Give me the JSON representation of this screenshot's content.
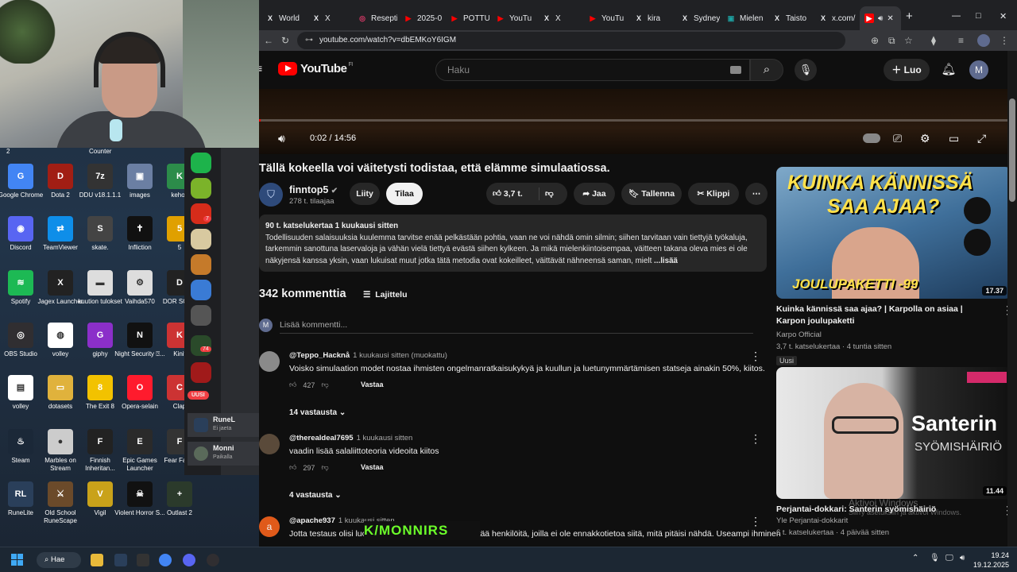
{
  "desktop": {
    "icons": [
      {
        "label": "Google Chrome",
        "color": "#4285f4",
        "glyph": "G"
      },
      {
        "label": "Dota 2",
        "color": "#a11e14",
        "glyph": "D"
      },
      {
        "label": "DDU v18.1.1.1",
        "color": "#333",
        "glyph": "7z"
      },
      {
        "label": "images",
        "color": "#6b7fa3",
        "glyph": "▣"
      },
      {
        "label": "kehok",
        "color": "#2c8c4a",
        "glyph": "K"
      },
      {
        "label": "Discord",
        "color": "#5865f2",
        "glyph": "◉"
      },
      {
        "label": "TeamViewer",
        "color": "#0e8ee9",
        "glyph": "⇄"
      },
      {
        "label": "skate.",
        "color": "#444",
        "glyph": "S"
      },
      {
        "label": "Infliction",
        "color": "#111",
        "glyph": "✝"
      },
      {
        "label": "5",
        "color": "#e0a000",
        "glyph": "5"
      },
      {
        "label": "Spotify",
        "color": "#1db954",
        "glyph": "≋"
      },
      {
        "label": "Jagex Launcher",
        "color": "#222",
        "glyph": "X"
      },
      {
        "label": "kuution tulokset",
        "color": "#ddd",
        "glyph": "▬"
      },
      {
        "label": "Vaihda570",
        "color": "#ddd",
        "glyph": "⚙"
      },
      {
        "label": "DOR SCRE",
        "color": "#222",
        "glyph": "D"
      },
      {
        "label": "OBS Studio",
        "color": "#302e31",
        "glyph": "◎"
      },
      {
        "label": "volley",
        "color": "#fff",
        "glyph": "◍"
      },
      {
        "label": "giphy",
        "color": "#8b2fc9",
        "glyph": "G"
      },
      {
        "label": "Night Security ⍰...",
        "color": "#111",
        "glyph": "N"
      },
      {
        "label": "Kinit",
        "color": "#c33",
        "glyph": "K"
      },
      {
        "label": "volley",
        "color": "#fff",
        "glyph": "▤"
      },
      {
        "label": "dotasets",
        "color": "#e0b23c",
        "glyph": "▭"
      },
      {
        "label": "The Exit 8",
        "color": "#f2c200",
        "glyph": "8"
      },
      {
        "label": "Opera-selain",
        "color": "#ff1b2d",
        "glyph": "O"
      },
      {
        "label": "Clap",
        "color": "#c33",
        "glyph": "C"
      },
      {
        "label": "Steam",
        "color": "#1b2838",
        "glyph": "♨"
      },
      {
        "label": "Marbles on Stream",
        "color": "#ccc",
        "glyph": "●"
      },
      {
        "label": "Finnish Inheritan...",
        "color": "#222",
        "glyph": "F"
      },
      {
        "label": "Epic Games Launcher",
        "color": "#2a2a2a",
        "glyph": "E"
      },
      {
        "label": "Fear Fathe",
        "color": "#333",
        "glyph": "F"
      },
      {
        "label": "RuneLite",
        "color": "#2a3f5a",
        "glyph": "RL"
      },
      {
        "label": "Old School RuneScape",
        "color": "#6b4a2a",
        "glyph": "⚔"
      },
      {
        "label": "Vigil",
        "color": "#c9a21a",
        "glyph": "V"
      },
      {
        "label": "Violent Horror S...",
        "color": "#111",
        "glyph": "☠"
      },
      {
        "label": "Outlast 2",
        "color": "#2b3a2b",
        "glyph": "+"
      }
    ],
    "above_icons_labels": [
      "2",
      "Counter"
    ]
  },
  "discord": {
    "badges": [
      "7",
      "74"
    ],
    "new_label": "UUSI",
    "items": [
      {
        "name": "RuneL",
        "status": "Ei jaeta"
      },
      {
        "name": "Monni",
        "status": "Paikalla"
      }
    ]
  },
  "browser": {
    "tabs": [
      {
        "label": "World",
        "fav": "#e8eaed",
        "glyph": "X"
      },
      {
        "label": "X",
        "fav": "#e8eaed",
        "glyph": "X"
      },
      {
        "label": "Resepti",
        "fav": "#e03a6a",
        "glyph": "◎"
      },
      {
        "label": "2025-0",
        "fav": "#ff0000",
        "glyph": "▶"
      },
      {
        "label": "POTTU",
        "fav": "#ff0000",
        "glyph": "▶"
      },
      {
        "label": "YouTu",
        "fav": "#ff0000",
        "glyph": "▶"
      },
      {
        "label": "X",
        "fav": "#e8eaed",
        "glyph": "X"
      },
      {
        "label": "YouTu",
        "fav": "#ff0000",
        "glyph": "▶"
      },
      {
        "label": "kira",
        "fav": "#e8eaed",
        "glyph": "X"
      },
      {
        "label": "Sydney",
        "fav": "#e8eaed",
        "glyph": "X"
      },
      {
        "label": "Mielen",
        "fav": "#1da1a1",
        "glyph": "▣"
      },
      {
        "label": "Taisto",
        "fav": "#e8eaed",
        "glyph": "X"
      },
      {
        "label": "x.com/",
        "fav": "#e8eaed",
        "glyph": "X"
      }
    ],
    "url": "youtube.com/watch?v=dbEMKoY6IGM",
    "new_tab": "+"
  },
  "youtube": {
    "region": "FI",
    "search_placeholder": "Haku",
    "create_label": "Luo",
    "avatar_letter": "M",
    "progress_fraction": 0.002,
    "time": "0:02 / 14:56",
    "title": "Tällä kokeella voi väitetysti todistaa, että elämme simulaatiossa.",
    "channel": "finntop5",
    "subscribers": "278 t. tilaajaa",
    "join_label": "Liity",
    "subscribe_label": "Tilaa",
    "likes": "3,7 t.",
    "share_label": "Jaa",
    "save_label": "Tallenna",
    "clip_label": "Klippi",
    "desc_meta": "90 t. katselukertaa  1 kuukausi sitten",
    "desc_text": "Todellisuuden salaisuuksia kuulemma tarvitse enää pelkästään pohtia, vaan ne voi nähdä omin silmin; siihen tarvitaan vain tiettyjä työkaluja, tarkemmin sanottuna laservaloja ja vähän vielä tiettyä evästä siihen kylkeen. Ja mikä mielenkiintoisempaa, väitteen takana oleva mies ei ole näkyjensä kanssa yksin, vaan lukuisat muut jotka tätä metodia ovat kokeilleet, väittävät nähneensä saman, mielt",
    "desc_more": "...lisää",
    "comment_count": "342 kommenttia",
    "sort_label": "Lajittelu",
    "add_comment": "Lisää kommentti...",
    "comments": [
      {
        "author": "@Teppo_Hacknå",
        "time": "1 kuukausi sitten (muokattu)",
        "text": "Voisko simulaation modet nostaa ihmisten ongelmanratkaisukykyä ja kuullun ja luetunymmärtämisen statseja ainakin 50%, kiitos.",
        "likes": "427",
        "reply": "Vastaa",
        "replies": "14 vastausta",
        "avatar": "#8a8a8a"
      },
      {
        "author": "@therealdeal7695",
        "time": "1 kuukausi sitten",
        "text": "vaadin lisää salaliittoteoria videoita kiitos",
        "likes": "297",
        "reply": "Vastaa",
        "replies": "4 vastausta",
        "avatar": "#5a4a3a"
      },
      {
        "author": "@apache937",
        "time": "1 kuukausi sitten",
        "text": "Jotta testaus olisi luotettavaa, testaajina pitäisi käyttää henkilöitä, joilla ei ole ennakkotietoa siitä, mitä pitäisi nähdä. Useampi ihminen",
        "likes": "",
        "reply": "",
        "replies": "",
        "avatar": "#e05a1a"
      }
    ],
    "recommendations": [
      {
        "thumb_top": "KUINKA KÄNNISSÄ",
        "thumb_sub": "SAA AJAA?",
        "thumb_bottom": "JOULUPAKETTI -99",
        "duration": "17.37",
        "title": "Kuinka kännissä saa ajaa? | Karpolla on asiaa | Karpon joulupaketti",
        "channel": "Karpo Official",
        "meta": "3,7 t. katselukertaa · 4 tuntia sitten",
        "badge": "Uusi"
      },
      {
        "thumb_top": "Santerin",
        "thumb_sub": "SYÖMISHÄIRIÖ",
        "thumb_bottom": "",
        "duration": "11.44",
        "title": "Perjantai-dokkari: Santerin syömishäiriö",
        "channel": "Yle Perjantai-dokkarit",
        "meta": "6 t. katselukertaa · 4 päivää sitten",
        "badge": ""
      }
    ],
    "watermark_title": "Aktivoi Windows",
    "watermark_sub": "Siirry asetuksiin ja aktivoi Windows.",
    "overlay": "K/MONNIRS"
  },
  "taskbar": {
    "search_label": "Hae",
    "time": "19.24",
    "date": "19.12.2025"
  }
}
